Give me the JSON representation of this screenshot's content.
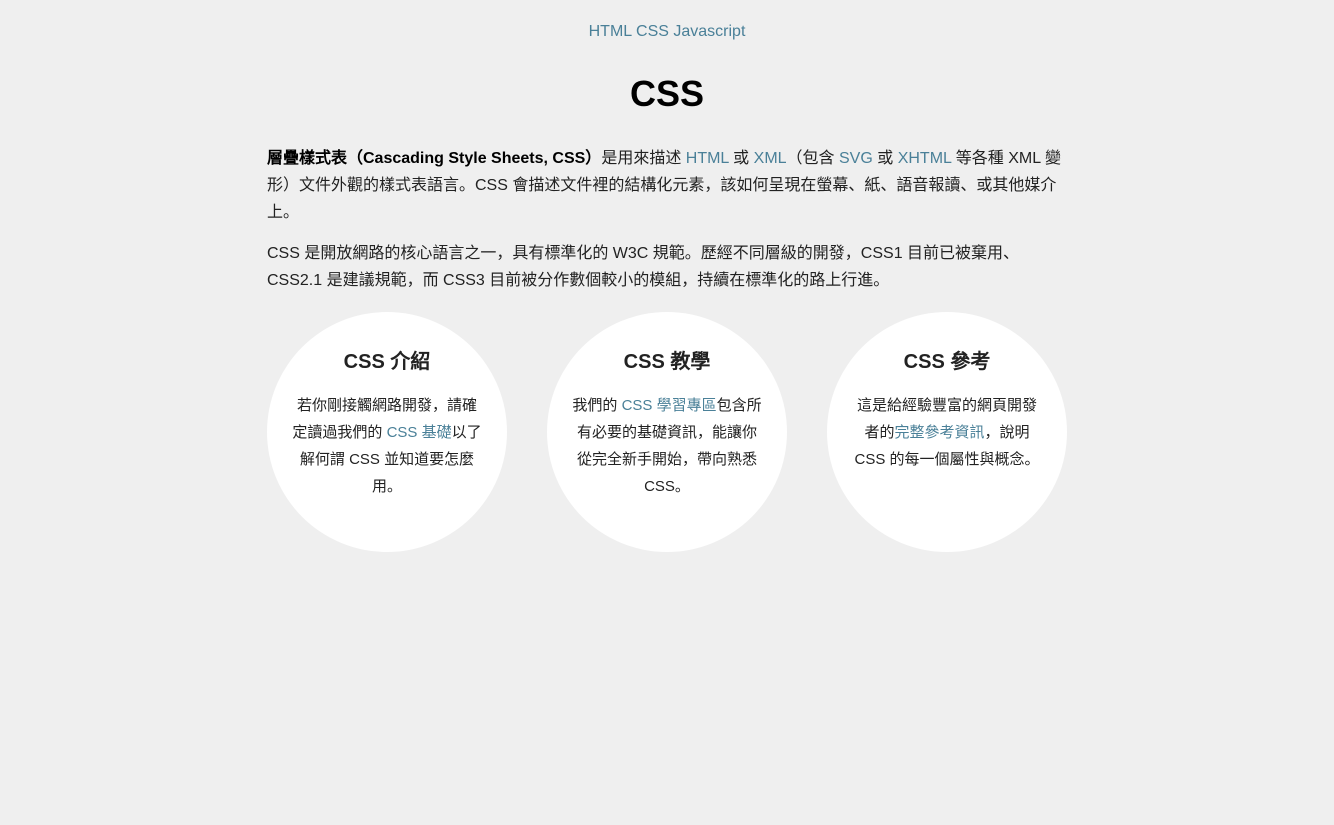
{
  "nav": {
    "link_label": "HTML CSS Javascript"
  },
  "page_title": "CSS",
  "intro": {
    "bold_term": "層疊樣式表（Cascading Style Sheets, CSS）",
    "t1": "是用來描述 ",
    "link_html": "HTML",
    "t2": " 或 ",
    "link_xml": "XML",
    "t3": "（包含 ",
    "link_svg": "SVG",
    "t4": " 或 ",
    "link_xhtml": "XHTML",
    "t5": " 等各種 XML 變形）文件外觀的樣式表語言。CSS 會描述文件裡的結構化元素，該如何呈現在螢幕、紙、語音報讀、或其他媒介上。"
  },
  "second_paragraph": "CSS 是開放網路的核心語言之一，具有標準化的 W3C 規範。歷經不同層級的開發，CSS1 目前已被棄用、CSS2.1 是建議規範，而 CSS3 目前被分作數個較小的模組，持續在標準化的路上行進。",
  "cards": {
    "intro": {
      "title": "CSS 介紹",
      "pre": "若你剛接觸網路開發，請確定讀過我們的 ",
      "link": "CSS 基礎",
      "post": "以了解何謂 CSS 並知道要怎麼用。"
    },
    "tutorial": {
      "title": "CSS 教學",
      "pre": "我們的 ",
      "link": "CSS 學習專區",
      "post": "包含所有必要的基礎資訊，能讓你從完全新手開始，帶向熟悉 CSS。"
    },
    "reference": {
      "title": "CSS 參考",
      "pre": "這是給經驗豐富的網頁開發者的",
      "link": "完整參考資訊",
      "post": "，說明 CSS 的每一個屬性與概念。"
    }
  },
  "colors": {
    "background": "#efefef",
    "link": "#4a8098",
    "circle": "#ffffff"
  }
}
